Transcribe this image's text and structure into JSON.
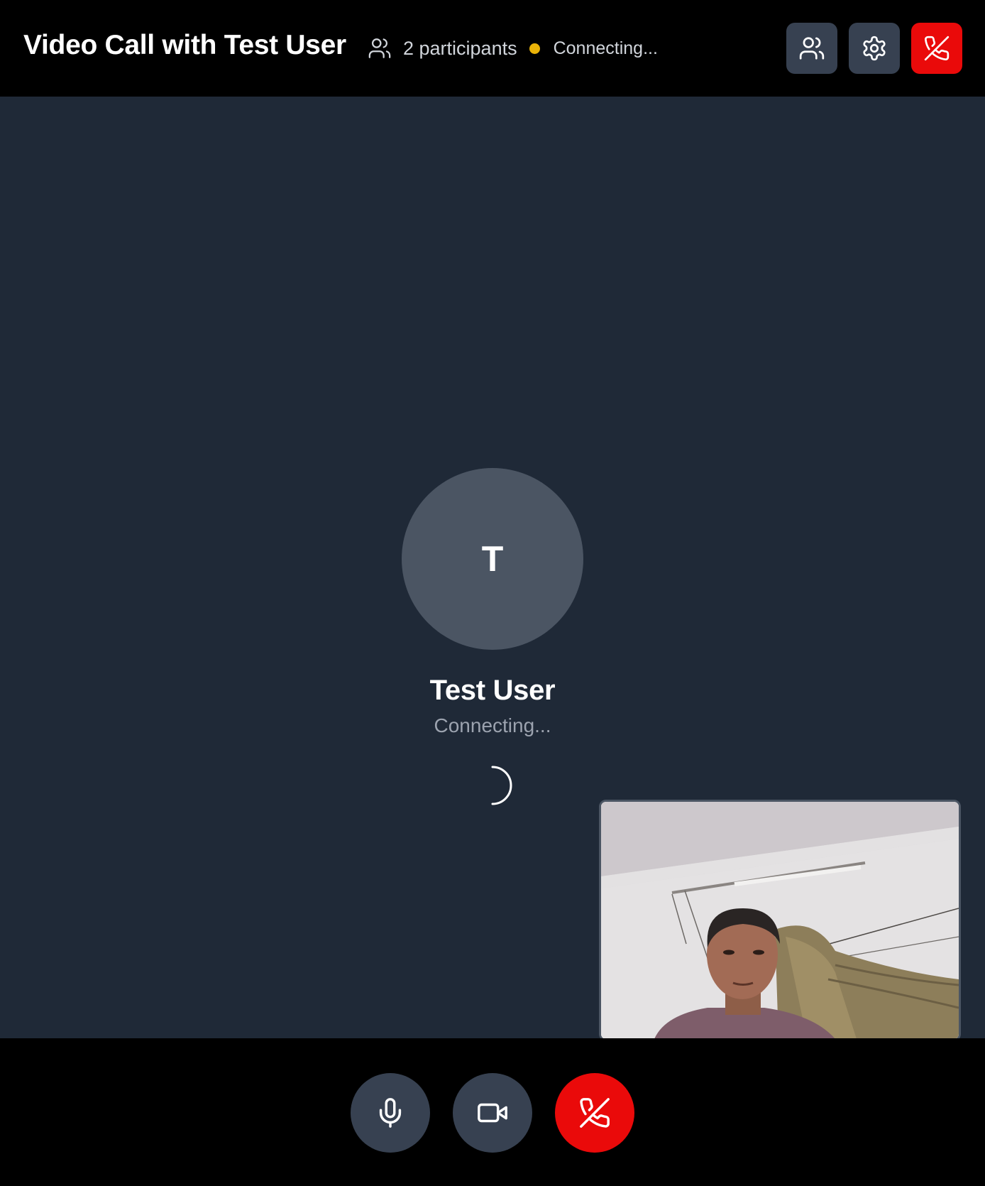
{
  "header": {
    "title": "Video Call with Test User",
    "participants_label": "2 participants",
    "connection_status": "Connecting...",
    "status_color": "#eab308",
    "buttons": [
      {
        "name": "participants-button",
        "icon": "users-icon"
      },
      {
        "name": "settings-button",
        "icon": "gear-icon"
      },
      {
        "name": "end-call-button",
        "icon": "phone-off-icon",
        "color": "#ea0a0a"
      }
    ]
  },
  "remote": {
    "initial": "T",
    "name": "Test User",
    "status": "Connecting..."
  },
  "self_view": {
    "content": "local camera preview"
  },
  "controls": [
    {
      "name": "microphone-button",
      "icon": "microphone-icon"
    },
    {
      "name": "camera-button",
      "icon": "video-camera-icon"
    },
    {
      "name": "hang-up-button",
      "icon": "phone-off-icon",
      "color": "#ea0a0a"
    }
  ],
  "colors": {
    "background": "#000000",
    "stage": "#1f2937",
    "button": "#374151",
    "avatar": "#4b5563",
    "danger": "#ea0a0a"
  }
}
